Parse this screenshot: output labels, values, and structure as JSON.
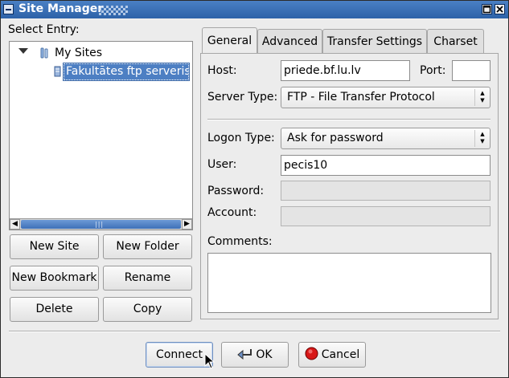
{
  "window": {
    "title": "Site Manager",
    "icon": "window-menu-icon",
    "controls": [
      "maximize-icon",
      "close-icon"
    ]
  },
  "tree": {
    "label": "Select Entry:",
    "root": {
      "label": "My Sites",
      "expanded": true,
      "icon": "folder-icon"
    },
    "children": [
      {
        "label": "Fakultātes ftp serveris",
        "selected": true,
        "icon": "server-icon"
      }
    ],
    "hscroll_position": 0.0
  },
  "left_buttons": {
    "new_site": "New Site",
    "new_folder": "New Folder",
    "new_bookmark": "New Bookmark",
    "rename": "Rename",
    "delete": "Delete",
    "copy": "Copy"
  },
  "tabs": [
    {
      "label": "General",
      "active": true
    },
    {
      "label": "Advanced",
      "active": false
    },
    {
      "label": "Transfer Settings",
      "active": false
    },
    {
      "label": "Charset",
      "active": false
    }
  ],
  "general": {
    "host_label": "Host:",
    "host_value": "priede.bf.lu.lv",
    "port_label": "Port:",
    "port_value": "",
    "server_type_label": "Server Type:",
    "server_type_value": "FTP - File Transfer Protocol",
    "logon_type_label": "Logon Type:",
    "logon_type_value": "Ask for password",
    "user_label": "User:",
    "user_value": "pecis10",
    "password_label": "Password:",
    "password_value": "",
    "account_label": "Account:",
    "account_value": "",
    "comments_label": "Comments:",
    "comments_value": ""
  },
  "footer": {
    "connect": "Connect",
    "ok": "OK",
    "cancel": "Cancel"
  },
  "colors": {
    "titlebar": "#2d62a8",
    "selection": "#4d7fc3",
    "cancel_icon": "#d81818"
  }
}
